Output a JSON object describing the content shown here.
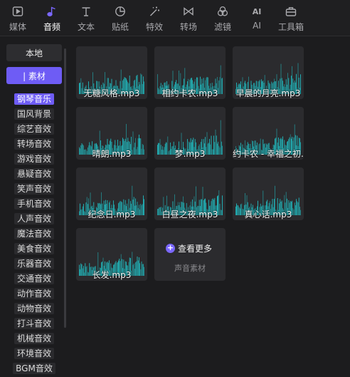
{
  "toolbar": {
    "tabs": [
      {
        "label": "媒体",
        "icon": "media-icon"
      },
      {
        "label": "音频",
        "icon": "music-note-icon",
        "active": true
      },
      {
        "label": "文本",
        "icon": "text-icon"
      },
      {
        "label": "贴纸",
        "icon": "sticker-icon"
      },
      {
        "label": "特效",
        "icon": "magic-wand-icon"
      },
      {
        "label": "转场",
        "icon": "transition-icon"
      },
      {
        "label": "滤镜",
        "icon": "filter-icon"
      },
      {
        "label": "AI",
        "icon": "ai-icon"
      },
      {
        "label": "工具箱",
        "icon": "toolbox-icon"
      }
    ]
  },
  "sidebar": {
    "local_label": "本地",
    "material_label": "| 素材",
    "categories": [
      "钢琴音乐",
      "国风背景",
      "综艺音效",
      "转场音效",
      "游戏音效",
      "悬疑音效",
      "笑声音效",
      "手机音效",
      "人声音效",
      "魔法音效",
      "美食音效",
      "乐器音效",
      "交通音效",
      "动作音效",
      "动物音效",
      "打斗音效",
      "机械音效",
      "环境音效",
      "BGM音效"
    ],
    "active_category": "钢琴音乐"
  },
  "audio_items": [
    {
      "title": "无糖风格.mp3"
    },
    {
      "title": "相约卡农.mp3"
    },
    {
      "title": "早晨的月亮.mp3"
    },
    {
      "title": "晴朗.mp3"
    },
    {
      "title": "梦.mp3"
    },
    {
      "title": "约卡农 - 幸福之初.m"
    },
    {
      "title": "纪念日.mp3"
    },
    {
      "title": "白昼之夜.mp3"
    },
    {
      "title": "真心话.mp3"
    },
    {
      "title": "长发.mp3"
    }
  ],
  "more": {
    "label": "查看更多",
    "sub_label": "声音素材"
  },
  "colors": {
    "accent": "#6e5cf5",
    "waveform": "#1fd3d8",
    "background": "#1c1c1e"
  }
}
